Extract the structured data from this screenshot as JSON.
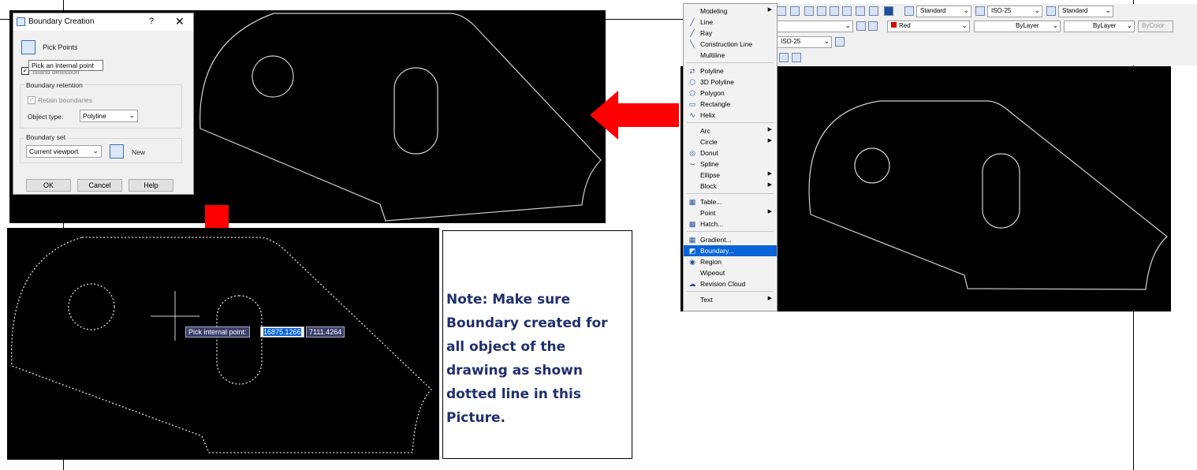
{
  "dialog": {
    "title": "Boundary Creation",
    "help_glyph": "?",
    "close_glyph": "✕",
    "pick_points_label": "Pick Points",
    "tooltip": "Pick an internal point",
    "island_detection_label": "Island detection",
    "boundary_retention_title": "Boundary retention",
    "retain_boundaries_label": "Retain boundaries",
    "object_type_label": "Object type:",
    "object_type_value": "Polyline",
    "boundary_set_title": "Boundary set",
    "boundary_set_value": "Current viewport",
    "new_label": "New",
    "ok_label": "OK",
    "cancel_label": "Cancel",
    "help_label": "Help"
  },
  "pick_prompt": {
    "label": "Pick internal point:",
    "x_value": "16875.1266",
    "y_value": "7111.4264"
  },
  "note": {
    "text": "Note: Make sure Boundary created for all object of the drawing as shown dotted line in this Picture."
  },
  "draw_menu": {
    "items": [
      {
        "label": "Modeling",
        "icon": "none",
        "submenu": true
      },
      {
        "label": "Line",
        "icon": "line-icon",
        "submenu": false
      },
      {
        "label": "Ray",
        "icon": "ray-icon",
        "submenu": false
      },
      {
        "label": "Construction Line",
        "icon": "construction-line-icon",
        "submenu": false
      },
      {
        "label": "Multiline",
        "icon": "none",
        "submenu": false
      },
      {
        "label": "Polyline",
        "icon": "polyline-icon",
        "submenu": false
      },
      {
        "label": "3D Polyline",
        "icon": "3d-polyline-icon",
        "submenu": false
      },
      {
        "label": "Polygon",
        "icon": "polygon-icon",
        "submenu": false
      },
      {
        "label": "Rectangle",
        "icon": "rectangle-icon",
        "submenu": false
      },
      {
        "label": "Helix",
        "icon": "helix-icon",
        "submenu": false
      },
      {
        "label": "Arc",
        "icon": "none",
        "submenu": true
      },
      {
        "label": "Circle",
        "icon": "none",
        "submenu": true
      },
      {
        "label": "Donut",
        "icon": "donut-icon",
        "submenu": false
      },
      {
        "label": "Spline",
        "icon": "spline-icon",
        "submenu": false
      },
      {
        "label": "Ellipse",
        "icon": "none",
        "submenu": true
      },
      {
        "label": "Block",
        "icon": "none",
        "submenu": true
      },
      {
        "label": "Table...",
        "icon": "table-icon",
        "submenu": false
      },
      {
        "label": "Point",
        "icon": "none",
        "submenu": true
      },
      {
        "label": "Hatch...",
        "icon": "hatch-icon",
        "submenu": false
      },
      {
        "label": "Gradient...",
        "icon": "gradient-icon",
        "submenu": false
      },
      {
        "label": "Boundary...",
        "icon": "boundary-icon",
        "submenu": false,
        "selected": true
      },
      {
        "label": "Region",
        "icon": "region-icon",
        "submenu": false
      },
      {
        "label": "Wipeout",
        "icon": "none",
        "submenu": false
      },
      {
        "label": "Revision Cloud",
        "icon": "revision-cloud-icon",
        "submenu": false
      },
      {
        "label": "Text",
        "icon": "none",
        "submenu": true
      }
    ]
  },
  "toolbar": {
    "text_style": "Standard",
    "dim_style": "ISO-25",
    "table_style": "Standard",
    "color": "Red",
    "linetype": "ByLayer",
    "lineweight": "ByLayer",
    "plot_style": "ByColor",
    "dim_style_2": "ISO-25"
  },
  "colors": {
    "arrow": "#ff0000",
    "menu_selected": "#0a64d8",
    "note_text": "#1f2f6e",
    "canvas": "#000000"
  }
}
